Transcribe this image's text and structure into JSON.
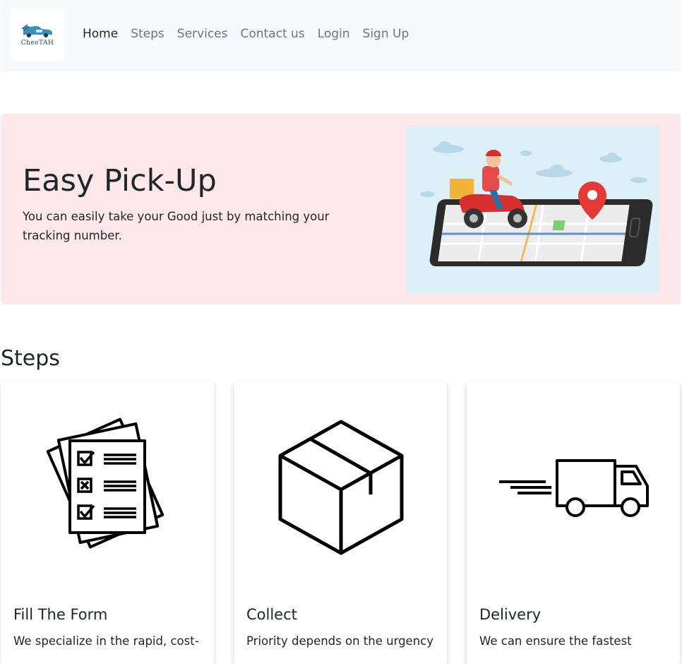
{
  "brand": {
    "logo_text": "CheeTAH"
  },
  "nav": {
    "items": [
      {
        "label": "Home",
        "active": true
      },
      {
        "label": "Steps",
        "active": false
      },
      {
        "label": "Services",
        "active": false
      },
      {
        "label": "Contact us",
        "active": false
      },
      {
        "label": "Login",
        "active": false
      },
      {
        "label": "Sign Up",
        "active": false
      }
    ]
  },
  "hero": {
    "title": "Easy Pick-Up",
    "text": "You can easily take your Good just by matching your tracking number.",
    "background": "#fce8e8"
  },
  "steps": {
    "heading": "Steps",
    "cards": [
      {
        "title": "Fill The Form",
        "text": "We specialize in the rapid, cost-",
        "icon": "checklist-icon"
      },
      {
        "title": "Collect",
        "text": "Priority depends on the urgency",
        "icon": "box-icon"
      },
      {
        "title": "Delivery",
        "text": "We can ensure the fastest",
        "icon": "truck-icon"
      }
    ]
  }
}
